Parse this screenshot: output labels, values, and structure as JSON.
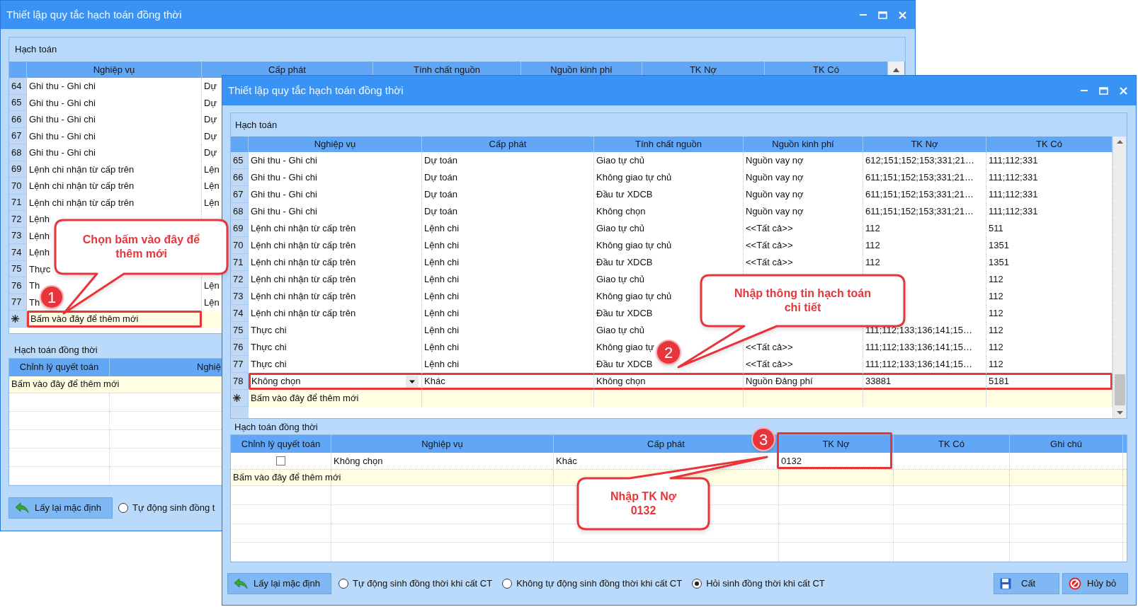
{
  "back_window": {
    "title": "Thiết lập quy tắc hạch toán đồng thời",
    "group_title": "Hạch toán",
    "columns": [
      "Nghiệp vụ",
      "Cấp phát",
      "Tính chất nguồn",
      "Nguồn kinh phí",
      "TK Nợ",
      "TK Có"
    ],
    "rows": [
      {
        "number": "64",
        "cells": [
          "Ghi thu - Ghi chi",
          "Dự"
        ]
      },
      {
        "number": "65",
        "cells": [
          "Ghi thu - Ghi chi",
          "Dự"
        ]
      },
      {
        "number": "66",
        "cells": [
          "Ghi thu - Ghi chi",
          "Dự"
        ]
      },
      {
        "number": "67",
        "cells": [
          "Ghi thu - Ghi chi",
          "Dự"
        ]
      },
      {
        "number": "68",
        "cells": [
          "Ghi thu - Ghi chi",
          "Dự"
        ]
      },
      {
        "number": "69",
        "cells": [
          "Lệnh chi nhận từ cấp trên",
          "Lện"
        ]
      },
      {
        "number": "70",
        "cells": [
          "Lệnh chi nhận từ cấp trên",
          "Lện"
        ]
      },
      {
        "number": "71",
        "cells": [
          "Lệnh chi nhận từ cấp trên",
          "Lện"
        ]
      },
      {
        "number": "72",
        "cells": [
          "Lệnh",
          null
        ]
      },
      {
        "number": "73",
        "cells": [
          "Lệnh",
          null
        ]
      },
      {
        "number": "74",
        "cells": [
          "Lệnh",
          null
        ]
      },
      {
        "number": "75",
        "cells": [
          "Thực",
          null
        ]
      },
      {
        "number": "76",
        "cells": [
          "Th",
          "Lện"
        ]
      },
      {
        "number": "77",
        "cells": [
          "Th",
          "Lện"
        ]
      }
    ],
    "new_row_text": "Bấm vào đây để thêm mới",
    "sub_group_title": "Hạch toán đồng thời",
    "sub_columns": [
      "Chỉnh lý quyết toán",
      "Nghiệ"
    ],
    "sub_new_row_text": "Bấm vào đây để thêm mới",
    "reset_button": "Lấy lại mặc định",
    "radio": {
      "label": "Tự động sinh đồng t",
      "selected": false
    }
  },
  "front_window": {
    "title": "Thiết lập quy tắc hạch toán đồng thời",
    "group_title": "Hạch toán",
    "columns": [
      "Nghiệp vụ",
      "Cấp phát",
      "Tính chất nguồn",
      "Nguồn kinh phí",
      "TK Nợ",
      "TK Có"
    ],
    "rows": [
      {
        "number": "65",
        "kind": "normal",
        "cells": [
          "Ghi thu - Ghi chi",
          "Dự toán",
          "Giao tự chủ",
          "Nguồn vay nợ",
          "612;151;152;153;331;21…",
          "111;112;331"
        ]
      },
      {
        "number": "66",
        "kind": "normal",
        "cells": [
          "Ghi thu - Ghi chi",
          "Dự toán",
          "Không giao tự chủ",
          "Nguồn vay nợ",
          "611;151;152;153;331;21…",
          "111;112;331"
        ]
      },
      {
        "number": "67",
        "kind": "normal",
        "cells": [
          "Ghi thu - Ghi chi",
          "Dự toán",
          "Đầu tư XDCB",
          "Nguồn vay nợ",
          "611;151;152;153;331;21…",
          "111;112;331"
        ]
      },
      {
        "number": "68",
        "kind": "normal",
        "cells": [
          "Ghi thu - Ghi chi",
          "Dự toán",
          "Không chọn",
          "Nguồn vay nợ",
          "611;151;152;153;331;21…",
          "111;112;331"
        ]
      },
      {
        "number": "69",
        "kind": "normal",
        "cells": [
          "Lệnh chi nhận từ cấp trên",
          "Lệnh chi",
          "Giao tự chủ",
          "<<Tất cả>>",
          "112",
          "511"
        ]
      },
      {
        "number": "70",
        "kind": "normal",
        "cells": [
          "Lệnh chi nhận từ cấp trên",
          "Lệnh chi",
          "Không giao tự chủ",
          "<<Tất cả>>",
          "112",
          "1351"
        ]
      },
      {
        "number": "71",
        "kind": "normal",
        "cells": [
          "Lệnh chi nhận từ cấp trên",
          "Lệnh chi",
          "Đầu tư XDCB",
          "<<Tất cả>>",
          "112",
          "1351"
        ]
      },
      {
        "number": "72",
        "kind": "normal",
        "cells": [
          "Lệnh chi nhận từ cấp trên",
          "Lệnh chi",
          "Giao tự chủ",
          null,
          null,
          "112"
        ]
      },
      {
        "number": "73",
        "kind": "normal",
        "cells": [
          "Lệnh chi nhận từ cấp trên",
          "Lệnh chi",
          "Không giao tự chủ",
          null,
          null,
          "112"
        ]
      },
      {
        "number": "74",
        "kind": "normal",
        "cells": [
          "Lệnh chi nhận từ cấp trên",
          "Lệnh chi",
          "Đầu tư XDCB",
          null,
          null,
          "112"
        ]
      },
      {
        "number": "75",
        "kind": "normal",
        "cells": [
          "Thực chi",
          "Lệnh chi",
          "Giao tự chủ",
          null,
          "111;112;133;136;141;15…",
          "112"
        ]
      },
      {
        "number": "76",
        "kind": "normal",
        "cells": [
          "Thực chi",
          "Lệnh chi",
          "Không giao tự",
          "<<Tất cả>>",
          "111;112;133;136;141;15…",
          "112"
        ]
      },
      {
        "number": "77",
        "kind": "normal",
        "cells": [
          "Thực chi",
          "Lệnh chi",
          "Đầu tư XDCB",
          "<<Tất cả>>",
          "111;112;133;136;141;15…",
          "112"
        ]
      },
      {
        "number": "78",
        "kind": "editing",
        "cells": [
          "Không chọn",
          "Khác",
          "Không chọn",
          "Nguồn Đảng phí",
          "33881",
          "5181"
        ]
      }
    ],
    "new_row_text": "Bấm vào đây để thêm mới",
    "sub_group_title": "Hạch toán đồng thời",
    "sub_columns": [
      "Chỉnh lý quyết toán",
      "Nghiệp vụ",
      "Cấp phát",
      "TK Nợ",
      "TK Có",
      "Ghi chú"
    ],
    "sub_rows": [
      {
        "checked": false,
        "cells": [
          "Không chọn",
          "Khác",
          "0132",
          null,
          null
        ]
      }
    ],
    "sub_new_row_text": "Bấm vào đây để thêm mới",
    "reset_button": "Lấy lại mặc định",
    "radios": [
      {
        "label": "Tự động sinh đồng thời khi cất CT",
        "selected": false
      },
      {
        "label": "Không tự động sinh đồng thời khi cất CT",
        "selected": false
      },
      {
        "label": "Hỏi sinh đồng thời khi cất CT",
        "selected": true
      }
    ],
    "save_button": "Cất",
    "cancel_button": "Hủy bỏ"
  },
  "callouts": [
    {
      "number": "1",
      "text": "Chọn bấm vào đây để thêm mới"
    },
    {
      "number": "2",
      "text": "Nhập thông tin hạch toán chi tiết"
    },
    {
      "number": "3",
      "text": "Nhập TK Nợ 0132"
    }
  ]
}
